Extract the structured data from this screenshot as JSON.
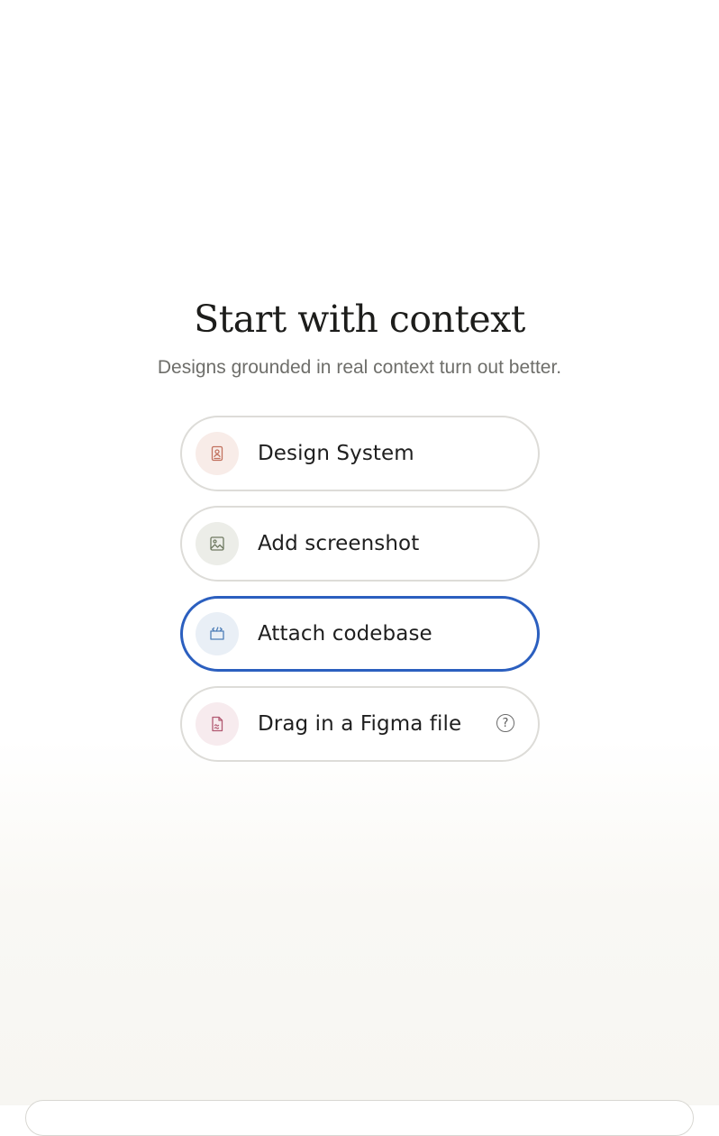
{
  "header": {
    "title": "Start with context",
    "subtitle": "Designs grounded in real context turn out better."
  },
  "options": [
    {
      "label": "Design System",
      "icon": "book-icon",
      "color": "#c2725f",
      "selected": false
    },
    {
      "label": "Add screenshot",
      "icon": "image-icon",
      "color": "#6f7a62",
      "selected": false
    },
    {
      "label": "Attach codebase",
      "icon": "code-folder-icon",
      "color": "#4f7fb8",
      "selected": true
    },
    {
      "label": "Drag in a Figma file",
      "icon": "file-icon",
      "color": "#b25a72",
      "selected": false,
      "help": "?"
    }
  ],
  "colors": {
    "selected_border": "#2b5fbf",
    "border": "#dddcd8"
  }
}
